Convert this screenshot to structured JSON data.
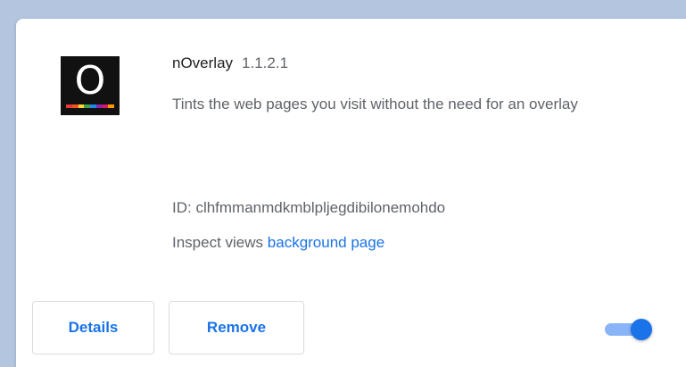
{
  "extension": {
    "icon": {
      "semantic": "noverlay-logo-icon",
      "letter": "O",
      "background": "#111111",
      "rainbow_colors": [
        "#e53935",
        "#f4511e",
        "#fdd835",
        "#43a047",
        "#1e88e5",
        "#8e24aa",
        "#d81b60",
        "#ff9800"
      ]
    },
    "name": "nOverlay",
    "version": "1.1.2.1",
    "description": "Tints the web pages you visit without the need for an overlay",
    "id_line": "ID: clhfmmanmdkmblpljegdibilonemohdo",
    "inspect_label": "Inspect views",
    "inspect_link": "background page"
  },
  "actions": {
    "details_label": "Details",
    "remove_label": "Remove",
    "enabled": true
  },
  "colors": {
    "accent": "#1a73e8",
    "toggle_track": "#8ab4f8",
    "page_background": "#b3c5df"
  }
}
